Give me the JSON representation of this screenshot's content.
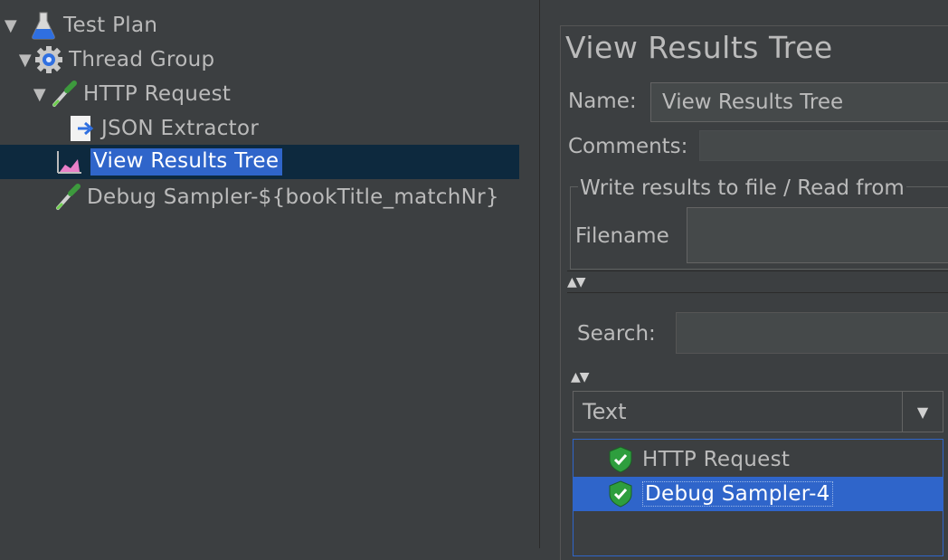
{
  "tree": {
    "items": [
      {
        "label": "Test Plan",
        "icon": "flask-icon"
      },
      {
        "label": "Thread Group",
        "icon": "gear-icon"
      },
      {
        "label": "HTTP Request",
        "icon": "pipette-icon"
      },
      {
        "label": "JSON Extractor",
        "icon": "json-extractor-icon"
      },
      {
        "label": "View Results Tree",
        "icon": "results-tree-icon"
      },
      {
        "label": "Debug Sampler-${bookTitle_matchNr}",
        "icon": "pipette-icon"
      }
    ],
    "selected": "View Results Tree"
  },
  "panel": {
    "title": "View Results Tree",
    "name_label": "Name:",
    "name_value": "View Results Tree",
    "comments_label": "Comments:",
    "comments_value": "",
    "write_results_label": "Write results to file / Read from",
    "filename_label": "Filename",
    "filename_value": "",
    "search_label": "Search:",
    "search_value": "",
    "renderer_selected": "Text"
  },
  "results": [
    {
      "label": "HTTP Request",
      "status": "success",
      "icon": "success-shield-icon"
    },
    {
      "label": "Debug Sampler-4",
      "status": "success",
      "icon": "success-shield-icon",
      "selected": true
    }
  ],
  "colors": {
    "background": "#3c3f41",
    "selection": "#2f65ca",
    "tree_selected_row": "#0d293e",
    "text": "#bbbbbb",
    "success_green": "#2e9e3e"
  }
}
